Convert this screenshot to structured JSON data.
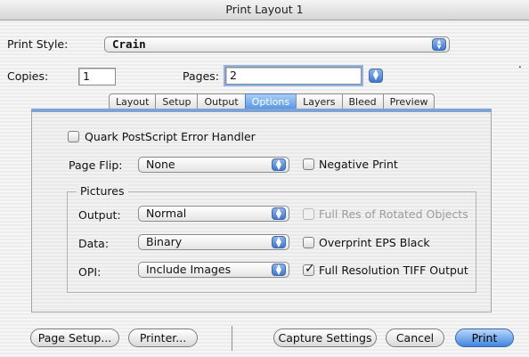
{
  "window": {
    "title": "Print Layout 1"
  },
  "print_style": {
    "label": "Print Style:",
    "value": "Crain"
  },
  "copies": {
    "label": "Copies:",
    "value": "1"
  },
  "pages": {
    "label": "Pages:",
    "value": "2"
  },
  "tabs": [
    {
      "label": "Layout",
      "active": false
    },
    {
      "label": "Setup",
      "active": false
    },
    {
      "label": "Output",
      "active": false
    },
    {
      "label": "Options",
      "active": true
    },
    {
      "label": "Layers",
      "active": false
    },
    {
      "label": "Bleed",
      "active": false
    },
    {
      "label": "Preview",
      "active": false
    }
  ],
  "options": {
    "error_handler": {
      "label": "Quark PostScript Error Handler",
      "checked": false
    },
    "page_flip": {
      "label": "Page Flip:",
      "value": "None"
    },
    "negative_print": {
      "label": "Negative Print",
      "checked": false
    },
    "pictures": {
      "title": "Pictures",
      "output": {
        "label": "Output:",
        "value": "Normal"
      },
      "data": {
        "label": "Data:",
        "value": "Binary"
      },
      "opi": {
        "label": "OPI:",
        "value": "Include Images"
      },
      "full_res_rotated": {
        "label": "Full Res of Rotated Objects",
        "checked": false,
        "enabled": false
      },
      "overprint_eps": {
        "label": "Overprint EPS Black",
        "checked": false
      },
      "full_res_tiff": {
        "label": "Full Resolution TIFF Output",
        "checked": true
      }
    }
  },
  "buttons": {
    "page_setup": "Page Setup...",
    "printer": "Printer...",
    "capture_settings": "Capture Settings",
    "cancel": "Cancel",
    "print": "Print"
  },
  "colors": {
    "accent": "#5596e2",
    "panel_border": "#7da2d4"
  }
}
